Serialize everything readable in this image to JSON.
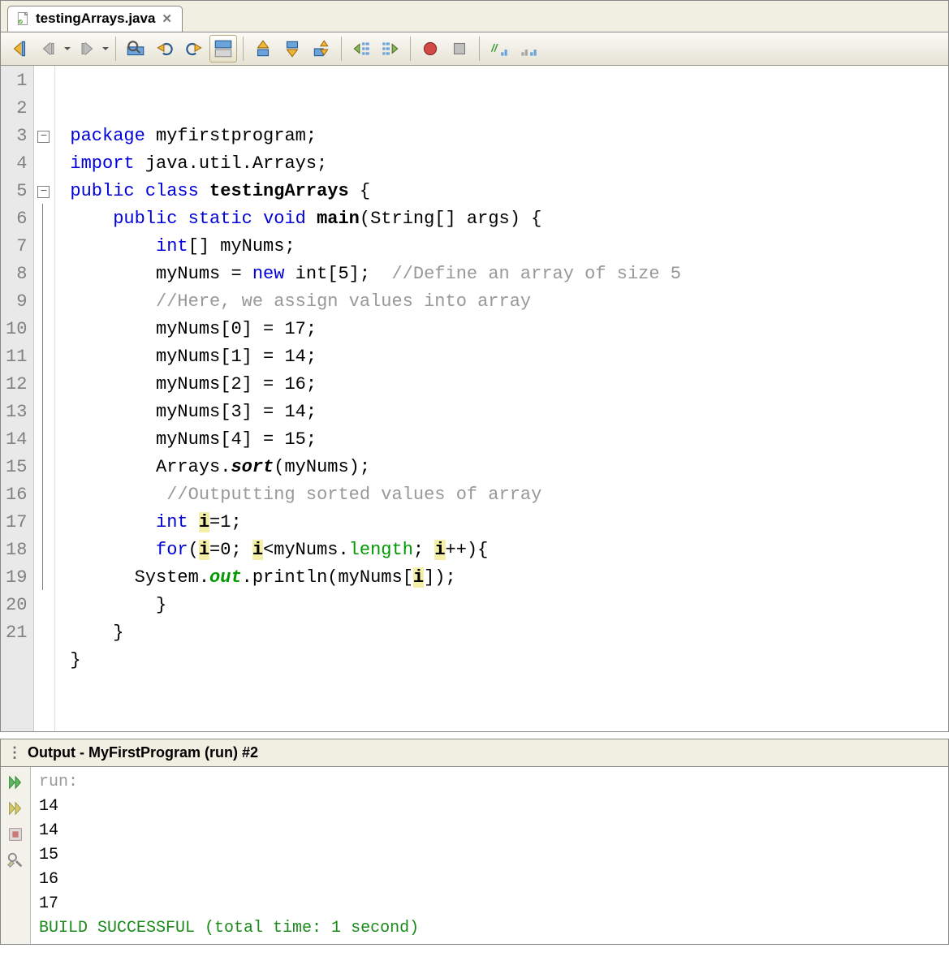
{
  "tab": {
    "filename": "testingArrays.java"
  },
  "editor": {
    "lines": [
      "1",
      "2",
      "3",
      "4",
      "5",
      "6",
      "7",
      "8",
      "9",
      "10",
      "11",
      "12",
      "13",
      "14",
      "15",
      "16",
      "17",
      "18",
      "19",
      "20",
      "21"
    ],
    "code": {
      "l2_kw": "package",
      "l2_rest": " myfirstprogram;",
      "l3_kw": "import",
      "l3_rest": " java.util.Arrays;",
      "l4_kw1": "public",
      "l4_kw2": "class",
      "l4_cls": "testingArrays",
      "l4_br": " {",
      "l5_kw1": "public",
      "l5_kw2": "static",
      "l5_kw3": "void",
      "l5_m": "main",
      "l5_sig": "(String[] args) {",
      "l6_kw": "int",
      "l6_rest": "[] myNums;",
      "l7_a": "myNums = ",
      "l7_kw": "new",
      "l7_b": " int[5];  ",
      "l7_cmt": "//Define an array of size 5",
      "l8_cmt": "//Here, we assign values into array",
      "l9": "myNums[0] = 17;",
      "l10": "myNums[1] = 14;",
      "l11": "myNums[2] = 16;",
      "l12": "myNums[3] = 14;",
      "l13": "myNums[4] = 15;",
      "l14_a": "Arrays.",
      "l14_m": "sort",
      "l14_b": "(myNums);",
      "l15_cmt": " //Outputting sorted values of array",
      "l16_kw": "int",
      "l16_sp": " ",
      "l16_i": "i",
      "l16_rest": "=1;",
      "l17_kw": "for",
      "l17_a": "(",
      "l17_i1": "i",
      "l17_b": "=0; ",
      "l17_i2": "i",
      "l17_c": "<myNums.",
      "l17_len": "length",
      "l17_d": "; ",
      "l17_i3": "i",
      "l17_e": "++){",
      "l18_a": "System.",
      "l18_out": "out",
      "l18_b": ".println(myNums[",
      "l18_i": "i",
      "l18_c": "]);",
      "l19": "}",
      "l20": "}",
      "l21": "}"
    }
  },
  "output": {
    "title": "Output - MyFirstProgram (run) #2",
    "run": "run:",
    "lines": [
      "14",
      "14",
      "15",
      "16",
      "17"
    ],
    "build": "BUILD SUCCESSFUL (total time: 1 second)"
  }
}
